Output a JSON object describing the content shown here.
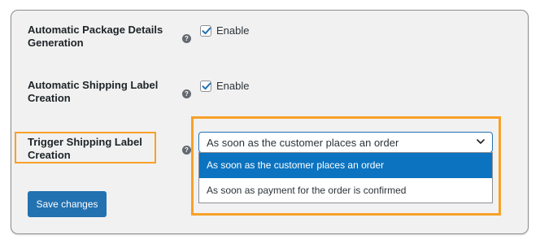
{
  "settings": {
    "auto_package": {
      "label": "Automatic Package Details Generation",
      "checked": true,
      "option_label": "Enable"
    },
    "auto_label": {
      "label": "Automatic Shipping Label Creation",
      "checked": true,
      "option_label": "Enable"
    },
    "trigger": {
      "label": "Trigger Shipping Label Creation",
      "selected_value": "As soon as the customer places an order",
      "options": [
        "As soon as the customer places an order",
        "As soon as payment for the order is confirmed"
      ]
    },
    "help_icon_glyph": "?"
  },
  "actions": {
    "save_label": "Save changes"
  },
  "colors": {
    "highlight": "#f7a128",
    "primary": "#2271b1",
    "option_selected": "#0b73c0"
  }
}
